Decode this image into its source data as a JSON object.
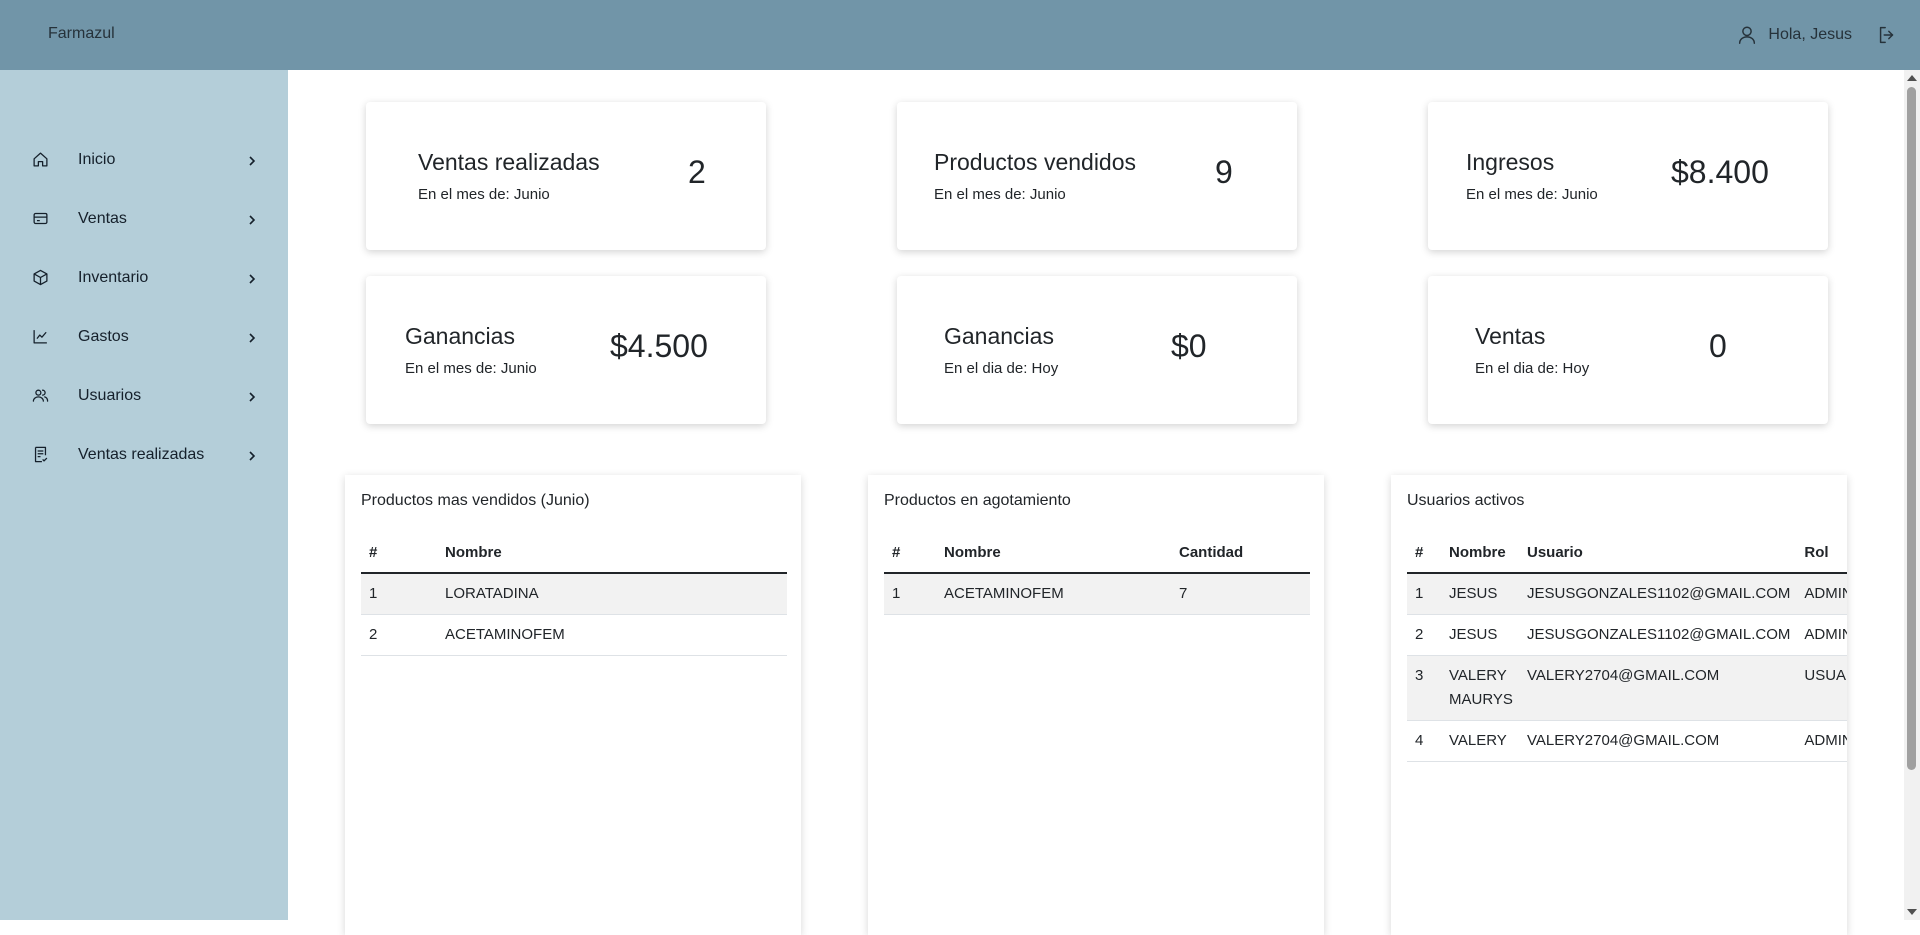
{
  "app": {
    "brand": "Farmazul"
  },
  "header": {
    "greeting": "Hola, Jesus"
  },
  "sidebar": {
    "items": [
      {
        "label": "Inicio",
        "icon": "home-icon"
      },
      {
        "label": "Ventas",
        "icon": "card-icon"
      },
      {
        "label": "Inventario",
        "icon": "box-icon"
      },
      {
        "label": "Gastos",
        "icon": "chart-line-icon"
      },
      {
        "label": "Usuarios",
        "icon": "users-icon"
      },
      {
        "label": "Ventas realizadas",
        "icon": "receipt-icon"
      }
    ]
  },
  "stats": [
    {
      "title": "Ventas realizadas",
      "sub": "En el mes de: Junio",
      "value": "2"
    },
    {
      "title": "Productos vendidos",
      "sub": "En el mes de: Junio",
      "value": "9"
    },
    {
      "title": "Ingresos",
      "sub": "En el mes de: Junio",
      "value": "$8.400"
    },
    {
      "title": "Ganancias",
      "sub": "En el mes de: Junio",
      "value": "$4.500"
    },
    {
      "title": "Ganancias",
      "sub": "En el dia de: Hoy",
      "value": "$0"
    },
    {
      "title": "Ventas",
      "sub": "En el dia de: Hoy",
      "value": "0"
    }
  ],
  "top_products": {
    "title": "Productos mas vendidos (Junio)",
    "columns": [
      "#",
      "Nombre"
    ],
    "rows": [
      [
        "1",
        "LORATADINA"
      ],
      [
        "2",
        "ACETAMINOFEM"
      ]
    ]
  },
  "low_stock": {
    "title": "Productos en agotamiento",
    "columns": [
      "#",
      "Nombre",
      "Cantidad"
    ],
    "rows": [
      [
        "1",
        "ACETAMINOFEM",
        "7"
      ]
    ]
  },
  "active_users": {
    "title": "Usuarios activos",
    "columns": [
      "#",
      "Nombre",
      "Usuario",
      "Rol"
    ],
    "rows": [
      [
        "1",
        "JESUS",
        "JESUSGONZALES1102@GMAIL.COM",
        "ADMIN"
      ],
      [
        "2",
        "JESUS",
        "JESUSGONZALES1102@GMAIL.COM",
        "ADMIN"
      ],
      [
        "3",
        "VALERY MAURYS",
        "VALERY2704@GMAIL.COM",
        "USUARIO"
      ],
      [
        "4",
        "VALERY",
        "VALERY2704@GMAIL.COM",
        "ADMIN"
      ]
    ]
  },
  "colors": {
    "topbar": "#7195a8",
    "sidebar": "#b4ced9"
  }
}
